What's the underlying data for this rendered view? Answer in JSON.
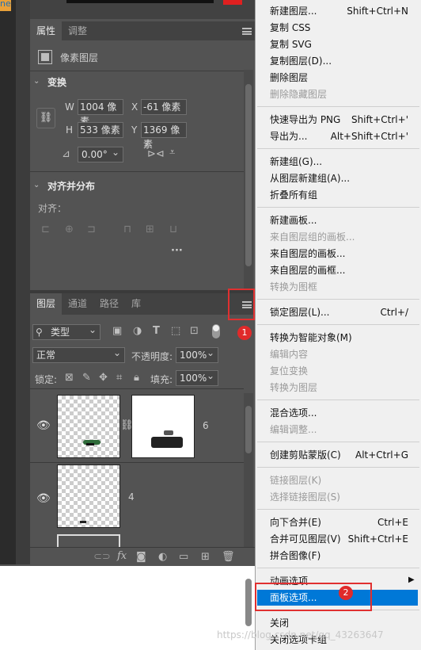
{
  "left_strip": {
    "label": "ne"
  },
  "properties_panel": {
    "tabs": [
      "属性",
      "调整"
    ],
    "layer_type": "像素图层",
    "transform": {
      "title": "变换",
      "w_label": "W",
      "w_value": "1004 像素",
      "x_label": "X",
      "x_value": "-61 像素",
      "h_label": "H",
      "h_value": "533 像素",
      "y_label": "Y",
      "y_value": "1369 像素",
      "angle_value": "0.00°"
    },
    "align": {
      "title": "对齐并分布",
      "label": "对齐："
    }
  },
  "layers_panel": {
    "tabs": [
      "图层",
      "通道",
      "路径",
      "库"
    ],
    "filter_type": "类型",
    "blend_mode": "正常",
    "opacity_label": "不透明度:",
    "opacity_value": "100%",
    "lock_label": "锁定:",
    "fill_label": "填充:",
    "fill_value": "100%",
    "layers": [
      {
        "name": "6",
        "visible": true
      },
      {
        "name": "4",
        "visible": true
      }
    ]
  },
  "badges": {
    "first": "1",
    "second": "2"
  },
  "watermark": "https://blog.csdn.net/qq_43263647",
  "menu": {
    "items": [
      {
        "label": "新建图层...",
        "shortcut": "Shift+Ctrl+N",
        "enabled": true
      },
      {
        "label": "复制 CSS",
        "shortcut": "",
        "enabled": true
      },
      {
        "label": "复制 SVG",
        "shortcut": "",
        "enabled": true
      },
      {
        "label": "复制图层(D)...",
        "shortcut": "",
        "enabled": true
      },
      {
        "label": "删除图层",
        "shortcut": "",
        "enabled": true
      },
      {
        "label": "删除隐藏图层",
        "shortcut": "",
        "enabled": false
      },
      {
        "label": "快速导出为 PNG",
        "shortcut": "Shift+Ctrl+'",
        "enabled": true
      },
      {
        "label": "导出为...",
        "shortcut": "Alt+Shift+Ctrl+'",
        "enabled": true
      },
      {
        "label": "新建组(G)...",
        "shortcut": "",
        "enabled": true
      },
      {
        "label": "从图层新建组(A)...",
        "shortcut": "",
        "enabled": true
      },
      {
        "label": "折叠所有组",
        "shortcut": "",
        "enabled": true
      },
      {
        "label": "新建画板...",
        "shortcut": "",
        "enabled": true
      },
      {
        "label": "来自图层组的画板...",
        "shortcut": "",
        "enabled": false
      },
      {
        "label": "来自图层的画板...",
        "shortcut": "",
        "enabled": true
      },
      {
        "label": "来自图层的画框...",
        "shortcut": "",
        "enabled": true
      },
      {
        "label": "转换为图框",
        "shortcut": "",
        "enabled": false
      },
      {
        "label": "锁定图层(L)...",
        "shortcut": "Ctrl+/",
        "enabled": true
      },
      {
        "label": "转换为智能对象(M)",
        "shortcut": "",
        "enabled": true
      },
      {
        "label": "编辑内容",
        "shortcut": "",
        "enabled": false
      },
      {
        "label": "复位变换",
        "shortcut": "",
        "enabled": false
      },
      {
        "label": "转换为图层",
        "shortcut": "",
        "enabled": false
      },
      {
        "label": "混合选项...",
        "shortcut": "",
        "enabled": true
      },
      {
        "label": "编辑调整...",
        "shortcut": "",
        "enabled": false
      },
      {
        "label": "创建剪贴蒙版(C)",
        "shortcut": "Alt+Ctrl+G",
        "enabled": true
      },
      {
        "label": "链接图层(K)",
        "shortcut": "",
        "enabled": false
      },
      {
        "label": "选择链接图层(S)",
        "shortcut": "",
        "enabled": false
      },
      {
        "label": "向下合并(E)",
        "shortcut": "Ctrl+E",
        "enabled": true
      },
      {
        "label": "合并可见图层(V)",
        "shortcut": "Shift+Ctrl+E",
        "enabled": true
      },
      {
        "label": "拼合图像(F)",
        "shortcut": "",
        "enabled": true
      },
      {
        "label": "动画选项",
        "shortcut": "",
        "enabled": true
      },
      {
        "label": "面板选项...",
        "shortcut": "",
        "enabled": true,
        "highlighted": true
      },
      {
        "label": "关闭",
        "shortcut": "",
        "enabled": true
      },
      {
        "label": "关闭选项卡组",
        "shortcut": "",
        "enabled": true
      }
    ]
  },
  "colors": {
    "menu_highlight": "#0078d7",
    "annotation_red": "#e03030",
    "panel_bg": "#535353"
  }
}
